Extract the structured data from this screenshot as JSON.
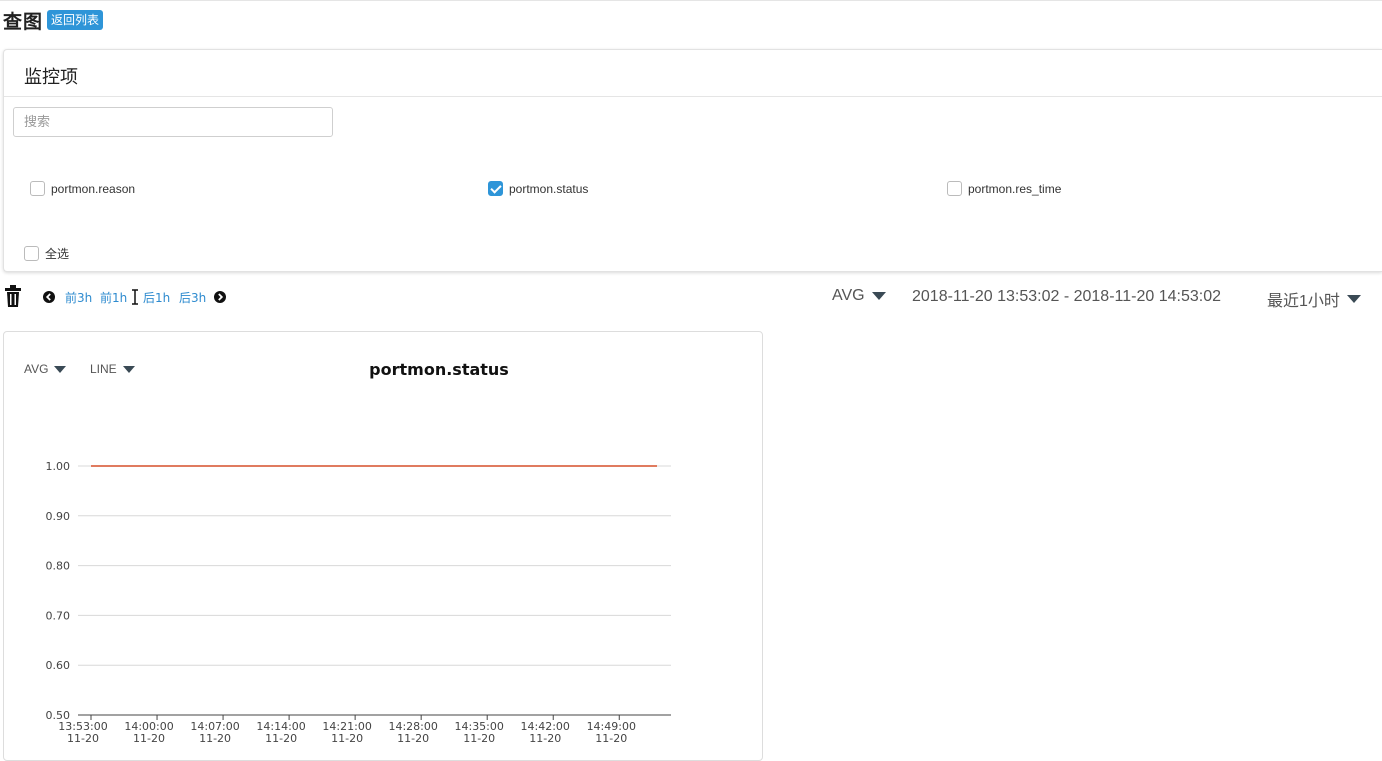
{
  "page": {
    "title": "查图",
    "back_label": "返回列表"
  },
  "monitor_panel": {
    "title": "监控项",
    "search_placeholder": "搜索",
    "items": [
      {
        "label": "portmon.reason",
        "checked": false
      },
      {
        "label": "portmon.status",
        "checked": true
      },
      {
        "label": "portmon.res_time",
        "checked": false
      }
    ],
    "select_all_label": "全选"
  },
  "toolbar": {
    "prev3h": "前3h",
    "prev1h": "前1h",
    "next1h": "后1h",
    "next3h": "后3h",
    "aggregation": "AVG",
    "time_range": "2018-11-20 13:53:02 - 2018-11-20 14:53:02",
    "relative_range": "最近1小时"
  },
  "chart_card": {
    "agg_select": "AVG",
    "type_select": "LINE",
    "title": "portmon.status",
    "colors": {
      "series": "#e07b5f",
      "grid": "#d8d8d8",
      "axis": "#444444"
    }
  },
  "chart_data": {
    "type": "line",
    "title": "portmon.status",
    "xlabel": "",
    "ylabel": "",
    "ylim": [
      0.5,
      1.0
    ],
    "y_ticks": [
      "1.00",
      "0.90",
      "0.80",
      "0.70",
      "0.60",
      "0.50"
    ],
    "x_ticks": [
      {
        "time": "13:53:00",
        "date": "11-20"
      },
      {
        "time": "14:00:00",
        "date": "11-20"
      },
      {
        "time": "14:07:00",
        "date": "11-20"
      },
      {
        "time": "14:14:00",
        "date": "11-20"
      },
      {
        "time": "14:21:00",
        "date": "11-20"
      },
      {
        "time": "14:28:00",
        "date": "11-20"
      },
      {
        "time": "14:35:00",
        "date": "11-20"
      },
      {
        "time": "14:42:00",
        "date": "11-20"
      },
      {
        "time": "14:49:00",
        "date": "11-20"
      }
    ],
    "series": [
      {
        "x": [
          "13:53:00",
          "14:53:00"
        ],
        "values": [
          1.0,
          1.0
        ]
      }
    ],
    "grid": true
  }
}
